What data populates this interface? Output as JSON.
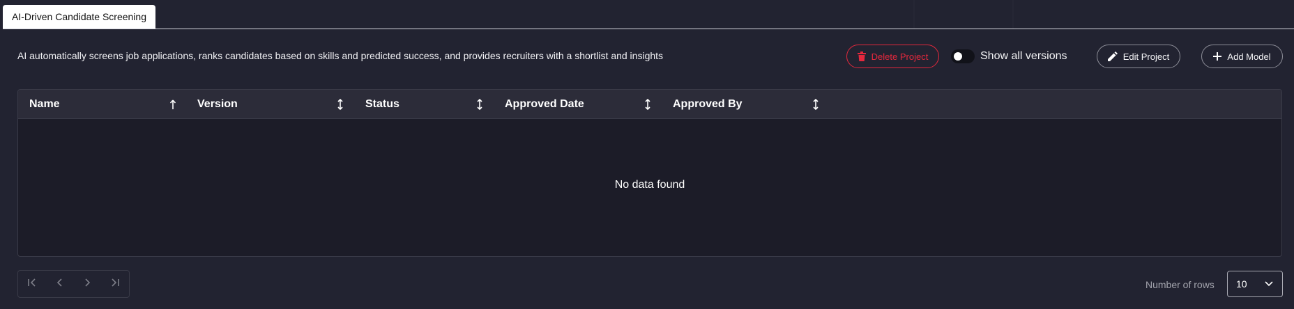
{
  "tabs": [
    {
      "label": "AI-Driven Candidate Screening",
      "active": true
    }
  ],
  "project": {
    "description": "AI automatically screens job applications, ranks candidates based on skills and predicted success, and provides recruiters with a shortlist and insights"
  },
  "actions": {
    "delete_label": "Delete Project",
    "show_versions_label": "Show all versions",
    "show_versions_on": false,
    "edit_label": "Edit Project",
    "add_label": "Add Model"
  },
  "table": {
    "columns": [
      {
        "label": "Name",
        "sort": "asc"
      },
      {
        "label": "Version",
        "sort": "none"
      },
      {
        "label": "Status",
        "sort": "none"
      },
      {
        "label": "Approved Date",
        "sort": "none"
      },
      {
        "label": "Approved By",
        "sort": "none"
      }
    ],
    "rows": [],
    "empty_text": "No data found"
  },
  "pagination": {
    "rows_label": "Number of rows",
    "rows_value": "10"
  },
  "colors": {
    "background": "#222331",
    "danger": "#e5283d",
    "table_header": "#2c2c39"
  }
}
